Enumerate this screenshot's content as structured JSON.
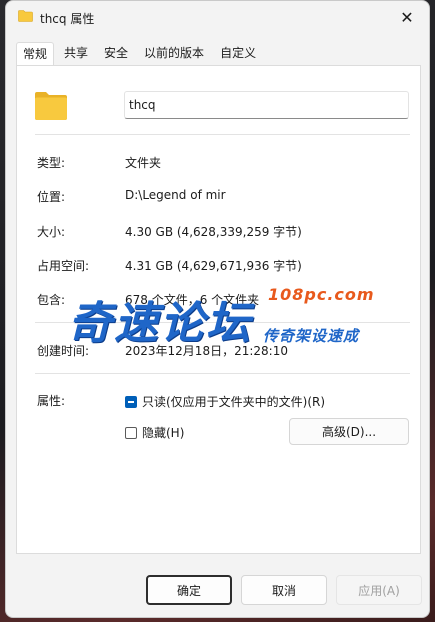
{
  "window": {
    "title": "thcq 属性",
    "close_glyph": "✕",
    "icon": "folder-icon"
  },
  "tabs": [
    {
      "label": "常规",
      "active": true
    },
    {
      "label": "共享"
    },
    {
      "label": "安全"
    },
    {
      "label": "以前的版本"
    },
    {
      "label": "自定义"
    }
  ],
  "general": {
    "name": "thcq",
    "rows": {
      "type": {
        "label": "类型:",
        "value": "文件夹"
      },
      "location": {
        "label": "位置:",
        "value": "D:\\Legend of mir"
      },
      "size": {
        "label": "大小:",
        "value": "4.30 GB (4,628,339,259 字节)"
      },
      "size_on_disk": {
        "label": "占用空间:",
        "value": "4.31 GB (4,629,671,936 字节)"
      },
      "contains": {
        "label": "包含:",
        "value": "678 个文件，6 个文件夹"
      },
      "created": {
        "label": "创建时间:",
        "value": "2023年12月18日，21:28:10"
      }
    },
    "attributes": {
      "label": "属性:",
      "readonly": {
        "label": "只读(仅应用于文件夹中的文件)(R)",
        "state": "indeterminate"
      },
      "hidden": {
        "label": "隐藏(H)",
        "checked": false
      },
      "advanced_button": "高级(D)..."
    }
  },
  "watermark": {
    "main": "奇速论坛",
    "domain": "108pc.com",
    "slogan": "传奇架设速成"
  },
  "footer": {
    "ok": "确定",
    "cancel": "取消",
    "apply": "应用(A)"
  },
  "colors": {
    "accent": "#005fb8",
    "folder_yellow": "#f8c93e",
    "watermark_blue": "#1f66c8",
    "watermark_orange": "#e8591c"
  }
}
